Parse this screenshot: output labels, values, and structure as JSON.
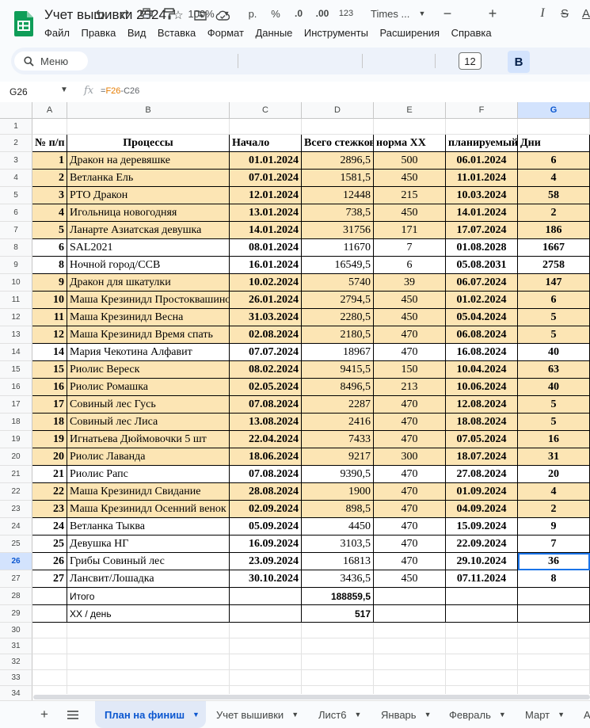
{
  "doc": {
    "title": "Учет вышивки 2024",
    "menu": [
      "Файл",
      "Правка",
      "Вид",
      "Вставка",
      "Формат",
      "Данные",
      "Инструменты",
      "Расширения",
      "Справка"
    ]
  },
  "toolbar": {
    "search_label": "Меню",
    "zoom": "100%",
    "currency": "р.",
    "percent": "%",
    "dec_decrease": ".0",
    "dec_increase": ".00",
    "number_format": "123",
    "font": "Times ...",
    "font_size": "12",
    "bold": "B",
    "italic": "I",
    "strike": "S",
    "text_color": "A"
  },
  "formula_bar": {
    "cell_ref": "G26",
    "formula_prefix": "=",
    "formula_ref1": "F26",
    "formula_rest": "-C26"
  },
  "columns": [
    "A",
    "B",
    "C",
    "D",
    "E",
    "F",
    "G"
  ],
  "header_row": {
    "a": "№ п/п",
    "b": "Процессы",
    "c": "Начало",
    "d": "Всего стежков",
    "e": "норма ХХ",
    "f": "планируемый",
    "g": "Дни"
  },
  "rows": [
    {
      "n": "1",
      "name": "Дракон на деревяшке",
      "start": "01.01.2024",
      "total": "2896,5",
      "norm": "500",
      "plan": "06.01.2024",
      "days": "6",
      "hl": true
    },
    {
      "n": "2",
      "name": "Ветланка Ель",
      "start": "07.01.2024",
      "total": "1581,5",
      "norm": "450",
      "plan": "11.01.2024",
      "days": "4",
      "hl": true
    },
    {
      "n": "3",
      "name": "РТО Дракон",
      "start": "12.01.2024",
      "total": "12448",
      "norm": "215",
      "plan": "10.03.2024",
      "days": "58",
      "hl": true
    },
    {
      "n": "4",
      "name": "Игольница новогодняя",
      "start": "13.01.2024",
      "total": "738,5",
      "norm": "450",
      "plan": "14.01.2024",
      "days": "2",
      "hl": true
    },
    {
      "n": "5",
      "name": "Ланарте  Азиатская девушка",
      "start": "14.01.2024",
      "total": "31756",
      "norm": "171",
      "plan": "17.07.2024",
      "days": "186",
      "hl": true
    },
    {
      "n": "6",
      "name": "SAL2021",
      "start": "08.01.2024",
      "total": "11670",
      "norm": "7",
      "plan": "01.08.2028",
      "days": "1667",
      "hl": false
    },
    {
      "n": "8",
      "name": "Ночной город/ССВ",
      "start": "16.01.2024",
      "total": "16549,5",
      "norm": "6",
      "plan": "05.08.2031",
      "days": "2758",
      "hl": false
    },
    {
      "n": "9",
      "name": "Дракон для шкатулки",
      "start": "10.02.2024",
      "total": "5740",
      "norm": "39",
      "plan": "06.07.2024",
      "days": "147",
      "hl": true
    },
    {
      "n": "10",
      "name": "Маша Крезинидл Простоквашино",
      "start": "26.01.2024",
      "total": "2794,5",
      "norm": "450",
      "plan": "01.02.2024",
      "days": "6",
      "hl": true
    },
    {
      "n": "11",
      "name": "Маша Крезинидл Весна",
      "start": "31.03.2024",
      "total": "2280,5",
      "norm": "450",
      "plan": "05.04.2024",
      "days": "5",
      "hl": true
    },
    {
      "n": "12",
      "name": "Маша Крезинидл Время спать",
      "start": "02.08.2024",
      "total": "2180,5",
      "norm": "470",
      "plan": "06.08.2024",
      "days": "5",
      "hl": true
    },
    {
      "n": "14",
      "name": "Мария Чекотина Алфавит",
      "start": "07.07.2024",
      "total": "18967",
      "norm": "470",
      "plan": "16.08.2024",
      "days": "40",
      "hl": false
    },
    {
      "n": "15",
      "name": "Риолис Вереск",
      "start": "08.02.2024",
      "total": "9415,5",
      "norm": "150",
      "plan": "10.04.2024",
      "days": "63",
      "hl": true
    },
    {
      "n": "16",
      "name": "Риолис Ромашка",
      "start": "02.05.2024",
      "total": "8496,5",
      "norm": "213",
      "plan": "10.06.2024",
      "days": "40",
      "hl": true
    },
    {
      "n": "17",
      "name": "Совиный лес Гусь",
      "start": "07.08.2024",
      "total": "2287",
      "norm": "470",
      "plan": "12.08.2024",
      "days": "5",
      "hl": true
    },
    {
      "n": "18",
      "name": "Совиный лес Лиса",
      "start": "13.08.2024",
      "total": "2416",
      "norm": "470",
      "plan": "18.08.2024",
      "days": "5",
      "hl": true
    },
    {
      "n": "19",
      "name": "Игнатьева Дюймовочки 5 шт",
      "start": "22.04.2024",
      "total": "7433",
      "norm": "470",
      "plan": "07.05.2024",
      "days": "16",
      "hl": true
    },
    {
      "n": "20",
      "name": "Риолис Лаванда",
      "start": "18.06.2024",
      "total": "9217",
      "norm": "300",
      "plan": "18.07.2024",
      "days": "31",
      "hl": true
    },
    {
      "n": "21",
      "name": "Риолис Рапс",
      "start": "07.08.2024",
      "total": "9390,5",
      "norm": "470",
      "plan": "27.08.2024",
      "days": "20",
      "hl": false
    },
    {
      "n": "22",
      "name": "Маша Крезинидл Свидание",
      "start": "28.08.2024",
      "total": "1900",
      "norm": "470",
      "plan": "01.09.2024",
      "days": "4",
      "hl": true
    },
    {
      "n": "23",
      "name": "Маша Крезинидл Осенний венок",
      "start": "02.09.2024",
      "total": "898,5",
      "norm": "470",
      "plan": "04.09.2024",
      "days": "2",
      "hl": true
    },
    {
      "n": "24",
      "name": "Ветланка Тыква",
      "start": "05.09.2024",
      "total": "4450",
      "norm": "470",
      "plan": "15.09.2024",
      "days": "9",
      "hl": false
    },
    {
      "n": "25",
      "name": "Девушка НГ",
      "start": "16.09.2024",
      "total": "3103,5",
      "norm": "470",
      "plan": "22.09.2024",
      "days": "7",
      "hl": false
    },
    {
      "n": "26",
      "name": "Грибы Совиный лес",
      "start": "23.09.2024",
      "total": "16813",
      "norm": "470",
      "plan": "29.10.2024",
      "days": "36",
      "hl": false
    },
    {
      "n": "27",
      "name": "Лансвит/Лошадка",
      "start": "30.10.2024",
      "total": "3436,5",
      "norm": "450",
      "plan": "07.11.2024",
      "days": "8",
      "hl": false
    }
  ],
  "totals": {
    "total_label": "Итого",
    "total_value": "188859,5",
    "per_day_label": "ХХ / день",
    "per_day_value": "517"
  },
  "row_numbers": [
    "1",
    "2",
    "3",
    "4",
    "5",
    "6",
    "7",
    "8",
    "9",
    "10",
    "11",
    "12",
    "13",
    "14",
    "15",
    "16",
    "17",
    "18",
    "19",
    "20",
    "21",
    "22",
    "23",
    "24",
    "25",
    "26",
    "27",
    "28",
    "29",
    "30",
    "31",
    "32",
    "33",
    "34"
  ],
  "sheet_tabs": [
    "План на финиш",
    "Учет вышивки",
    "Лист6",
    "Январь",
    "Февраль",
    "Март",
    "А"
  ],
  "colors": {
    "highlight": "#fce5b4",
    "selection": "#1a73e8",
    "sheets_green": "#0f9d58"
  }
}
